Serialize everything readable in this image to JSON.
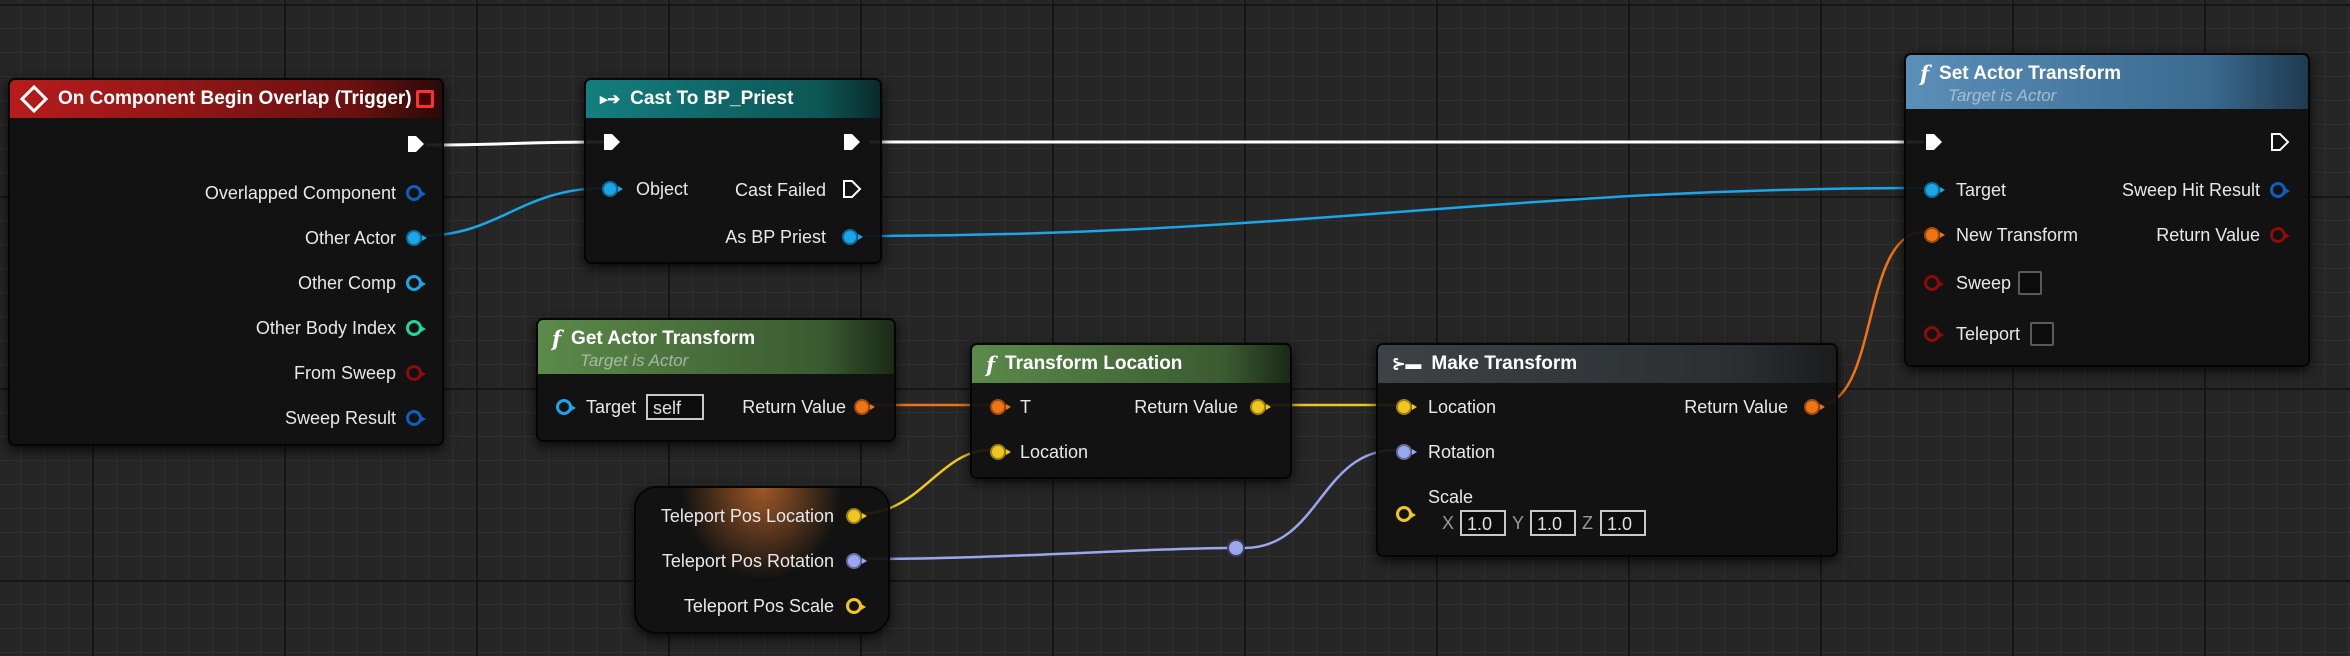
{
  "colors": {
    "exec": "#ffffff",
    "object": "#1aa6e8",
    "struct": "#0d5fbf",
    "int": "#1ed6a0",
    "bool": "#8c0b0b",
    "transform": "#f07414",
    "vector": "#f0c61f",
    "rotator": "#9aa7ee"
  },
  "nodes": {
    "overlap": {
      "title": "On Component Begin Overlap (Trigger)",
      "icon": "event-diamond-icon",
      "outputs": [
        "Overlapped Component",
        "Other Actor",
        "Other Comp",
        "Other Body Index",
        "From Sweep",
        "Sweep Result"
      ]
    },
    "cast": {
      "title": "Cast To BP_Priest",
      "icon": "cast-arrows-icon",
      "input_object": "Object",
      "cast_failed": "Cast Failed",
      "as_output": "As BP Priest"
    },
    "get_transform": {
      "title": "Get Actor Transform",
      "subtitle": "Target is Actor",
      "target_label": "Target",
      "target_value": "self",
      "return_label": "Return Value"
    },
    "transform_location": {
      "title": "Transform Location",
      "t_label": "T",
      "location_label": "Location",
      "return_label": "Return Value"
    },
    "make_transform": {
      "title": "Make Transform",
      "location_label": "Location",
      "rotation_label": "Rotation",
      "scale_label": "Scale",
      "x_label": "X",
      "x_value": "1.0",
      "y_label": "Y",
      "y_value": "1.0",
      "z_label": "Z",
      "z_value": "1.0",
      "return_label": "Return Value"
    },
    "set_transform": {
      "title": "Set Actor Transform",
      "subtitle": "Target is Actor",
      "target_label": "Target",
      "new_transform_label": "New Transform",
      "sweep_label": "Sweep",
      "teleport_label": "Teleport",
      "sweep_hit_label": "Sweep Hit Result",
      "return_label": "Return Value"
    },
    "variables": {
      "location": "Teleport Pos Location",
      "rotation": "Teleport Pos Rotation",
      "scale": "Teleport Pos Scale"
    }
  }
}
